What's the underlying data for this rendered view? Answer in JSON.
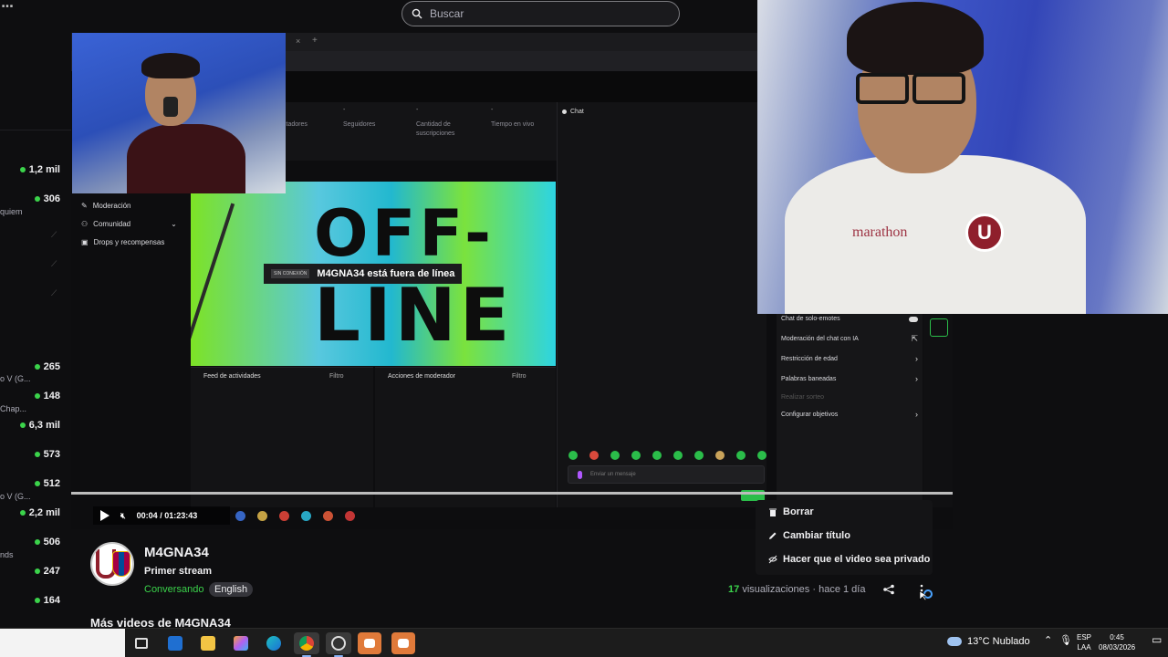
{
  "search": {
    "placeholder": "Buscar"
  },
  "sidebar": {
    "counts": [
      "1,2 mil",
      "306",
      "265",
      "148",
      "6,3 mil",
      "573",
      "512",
      "2,2 mil",
      "506",
      "247",
      "164"
    ],
    "labels": [
      "quiem",
      "o V (G...",
      "Chap...",
      "o V (G...",
      "nds"
    ],
    "colors": {
      "live_dot": "#3bd34b"
    }
  },
  "dashboard": {
    "stats": [
      "ctadores",
      "Seguidores",
      "Cantidad de suscripciones",
      "Tiempo en vivo"
    ],
    "menu": [
      "Moderación",
      "Comunidad",
      "Drops y recompensas"
    ],
    "chat_title": "Chat",
    "offline": {
      "line1": "OFF-",
      "line2": "LINE",
      "badge": "SIN CONEXIÓN",
      "message": "M4GNA34 está fuera de línea"
    },
    "activity_feed": "Feed de actividades",
    "mod_actions": "Acciones de moderador",
    "filter": "Filtro",
    "message_placeholder": "Enviar un mensaje",
    "settings": [
      "Chat de solo-emotes",
      "Moderación del chat con IA",
      "Restricción de edad",
      "Palabras baneadas",
      "Realizar sorteo",
      "Configurar objetivos"
    ]
  },
  "player": {
    "time_current": "00:04",
    "time_separator": "/",
    "time_total": "01:23:43"
  },
  "webcam_big": {
    "shirt_text": "marathon",
    "crest": "U"
  },
  "channel": {
    "name": "M4GNA34",
    "stream_title": "Primer stream",
    "category": "Conversando",
    "language": "English",
    "views_count": "17",
    "views_label": "visualizaciones",
    "time_ago": "hace 1 día",
    "more_videos": "Más videos de M4GNA34"
  },
  "context_menu": {
    "items": [
      "Borrar",
      "Cambiar título",
      "Hacer que el video sea privado"
    ]
  },
  "taskbar": {
    "weather": "13°C  Nublado",
    "lang_line1": "ESP",
    "lang_line2": "LAA",
    "time": "0:45",
    "date": "08/03/2026"
  }
}
